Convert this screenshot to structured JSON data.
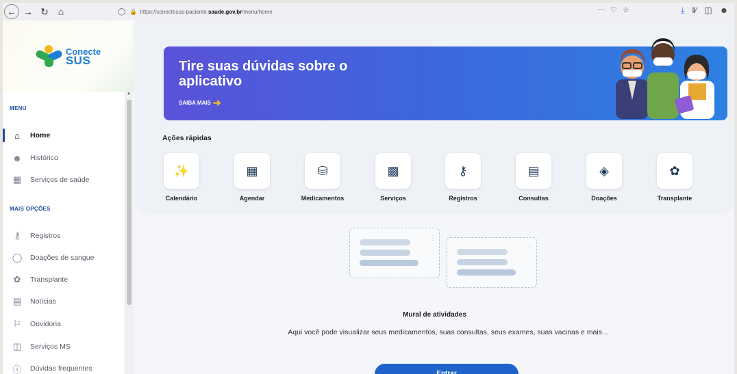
{
  "browser": {
    "url_prefix": "https://conectesus-paciente.",
    "url_host": "saude.gov.br",
    "url_path": "/menu/home",
    "page_actions": "···",
    "icons": [
      "back-icon",
      "forward-icon",
      "reload-icon",
      "home-icon",
      "shield-icon",
      "lock-icon",
      "pocket-icon",
      "bookmark-star-icon",
      "download-icon",
      "library-icon",
      "sidebar-icon",
      "account-icon"
    ]
  },
  "sidebar": {
    "logo": {
      "line1": "Conecte",
      "line2": "SUS"
    },
    "menu_label": "MENU",
    "menu_items": [
      {
        "label": "Home",
        "icon": "home-icon"
      },
      {
        "label": "Histórico",
        "icon": "user-icon"
      },
      {
        "label": "Serviços de saúde",
        "icon": "calendar-icon"
      }
    ],
    "more_label": "MAIS OPÇÕES",
    "more_items": [
      {
        "label": "Registros",
        "icon": "vial-icon"
      },
      {
        "label": "Doações de sangue",
        "icon": "blood-drop-icon"
      },
      {
        "label": "Transplante",
        "icon": "lungs-icon"
      },
      {
        "label": "Notícias",
        "icon": "news-icon"
      },
      {
        "label": "Ouvidoria",
        "icon": "flag-icon"
      },
      {
        "label": "Serviços MS",
        "icon": "services-icon"
      },
      {
        "label": "Dúvidas frequentes",
        "icon": "help-icon"
      }
    ]
  },
  "banner": {
    "title": "Tire suas dúvidas sobre o aplicativo",
    "link": "SAIBA MAIS"
  },
  "quick_actions": {
    "title": "Ações rápidas",
    "items": [
      {
        "label": "Calendário",
        "icon": "syringe-icon"
      },
      {
        "label": "Agendar",
        "icon": "calendar-plus-icon"
      },
      {
        "label": "Medicamentos",
        "icon": "pill-jar-icon"
      },
      {
        "label": "Serviços",
        "icon": "hospital-icon"
      },
      {
        "label": "Registros",
        "icon": "vial-icon"
      },
      {
        "label": "Consultas",
        "icon": "clipboard-icon"
      },
      {
        "label": "Doações",
        "icon": "blood-drop-icon"
      },
      {
        "label": "Transplante",
        "icon": "lungs-icon"
      }
    ]
  },
  "mural": {
    "title": "Mural de atividades",
    "description": "Aqui você pode visualizar seus medicamentos, suas consultas, seus exames, suas vacinas e mais...",
    "button": "Entrar"
  },
  "colors": {
    "accent": "#1d4fa0",
    "banner_start": "#5a52d9",
    "banner_end": "#2d80e2",
    "cta": "#1d63c9"
  }
}
